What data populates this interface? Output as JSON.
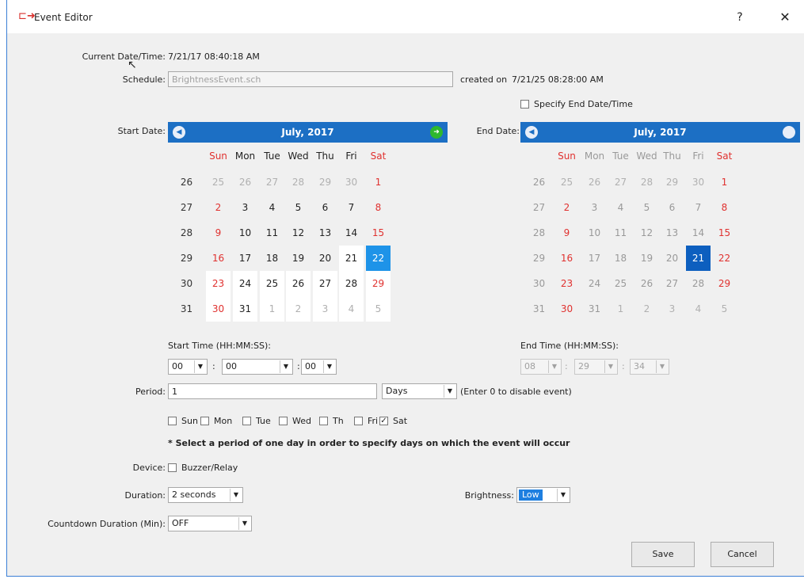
{
  "window": {
    "title": "Event Editor",
    "help_label": "?",
    "close_label": "✕"
  },
  "current": {
    "label": "Current Date/Time:",
    "value": "7/21/17 08:40:18 AM"
  },
  "schedule": {
    "label": "Schedule:",
    "value": "BrightnessEvent.sch",
    "created_label": "created on",
    "created_value": "7/21/25 08:28:00 AM"
  },
  "end_toggle": {
    "label": "Specify End Date/Time",
    "checked": false
  },
  "start_cal": {
    "label": "Start Date:",
    "month": "July,  2017",
    "prev_label": "◀",
    "next_label": "➜",
    "weekdays": [
      "Sun",
      "Mon",
      "Tue",
      "Wed",
      "Thu",
      "Fri",
      "Sat"
    ],
    "weeks": [
      {
        "num": "26",
        "days": [
          "25",
          "26",
          "27",
          "28",
          "29",
          "30",
          "1"
        ]
      },
      {
        "num": "27",
        "days": [
          "2",
          "3",
          "4",
          "5",
          "6",
          "7",
          "8"
        ]
      },
      {
        "num": "28",
        "days": [
          "9",
          "10",
          "11",
          "12",
          "13",
          "14",
          "15"
        ]
      },
      {
        "num": "29",
        "days": [
          "16",
          "17",
          "18",
          "19",
          "20",
          "21",
          "22"
        ]
      },
      {
        "num": "30",
        "days": [
          "23",
          "24",
          "25",
          "26",
          "27",
          "28",
          "29"
        ]
      },
      {
        "num": "31",
        "days": [
          "30",
          "31",
          "1",
          "2",
          "3",
          "4",
          "5"
        ]
      }
    ],
    "selected": "22"
  },
  "end_cal": {
    "label": "End Date:",
    "month": "July,  2017",
    "prev_label": "◀",
    "next_label": "●",
    "weekdays": [
      "Sun",
      "Mon",
      "Tue",
      "Wed",
      "Thu",
      "Fri",
      "Sat"
    ],
    "weeks": [
      {
        "num": "26",
        "days": [
          "25",
          "26",
          "27",
          "28",
          "29",
          "30",
          "1"
        ]
      },
      {
        "num": "27",
        "days": [
          "2",
          "3",
          "4",
          "5",
          "6",
          "7",
          "8"
        ]
      },
      {
        "num": "28",
        "days": [
          "9",
          "10",
          "11",
          "12",
          "13",
          "14",
          "15"
        ]
      },
      {
        "num": "29",
        "days": [
          "16",
          "17",
          "18",
          "19",
          "20",
          "21",
          "22"
        ]
      },
      {
        "num": "30",
        "days": [
          "23",
          "24",
          "25",
          "26",
          "27",
          "28",
          "29"
        ]
      },
      {
        "num": "31",
        "days": [
          "30",
          "31",
          "1",
          "2",
          "3",
          "4",
          "5"
        ]
      }
    ],
    "selected": "21"
  },
  "start_time": {
    "label": "Start Time (HH:MM:SS):",
    "hh": "00",
    "mm": "00",
    "ss": "00",
    "sep": ":"
  },
  "end_time": {
    "label": "End Time (HH:MM:SS):",
    "hh": "08",
    "mm": "29",
    "ss": "34",
    "sep": ":"
  },
  "period": {
    "label": "Period:",
    "value": "1",
    "unit": "Days",
    "hint": "(Enter 0 to disable event)"
  },
  "days": [
    {
      "label": "Sun",
      "checked": false
    },
    {
      "label": "Mon",
      "checked": false
    },
    {
      "label": "Tue",
      "checked": false
    },
    {
      "label": "Wed",
      "checked": false
    },
    {
      "label": "Th",
      "checked": false
    },
    {
      "label": "Fri",
      "checked": false
    },
    {
      "label": "Sat",
      "checked": true
    }
  ],
  "note": "* Select a period of one day in order to specify days on which the event will occur",
  "device": {
    "label": "Device:",
    "option": "Buzzer/Relay",
    "checked": false
  },
  "duration": {
    "label": "Duration:",
    "value": "2 seconds"
  },
  "brightness": {
    "label": "Brightness:",
    "value": "Low"
  },
  "countdown": {
    "label": "Countdown Duration (Min):",
    "value": "OFF"
  },
  "buttons": {
    "save": "Save",
    "cancel": "Cancel"
  }
}
